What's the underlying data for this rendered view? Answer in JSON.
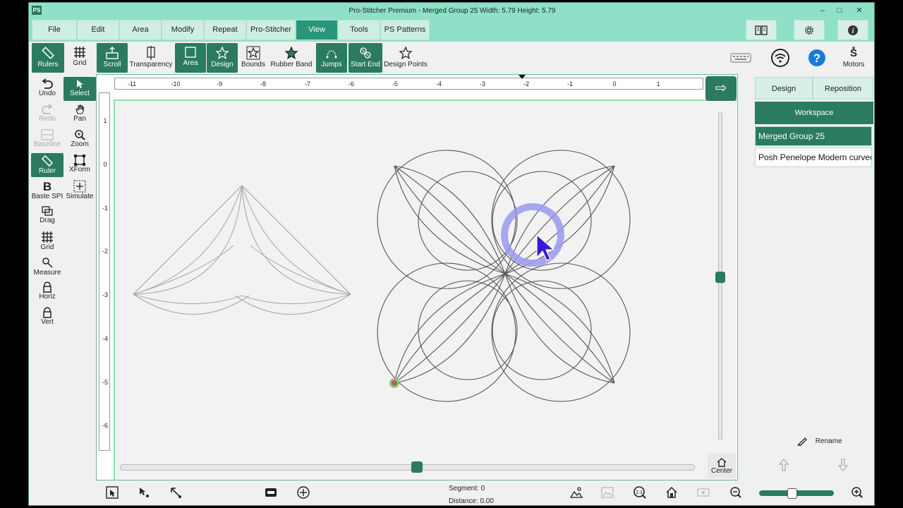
{
  "window": {
    "app_icon_text": "PS",
    "title": "Pro-Stitcher Premium   -   Merged Group 25   Width: 5.79   Height: 5.79"
  },
  "menu": {
    "tabs": [
      "File",
      "Edit",
      "Area",
      "Modify",
      "Repeat",
      "Pro-Stitcher",
      "View",
      "Tools",
      "PS Patterns"
    ],
    "active": "View",
    "right_buttons": [
      "book-icon",
      "gear-icon",
      "info-icon"
    ]
  },
  "toolbar": {
    "items": [
      "Rulers",
      "Grid",
      "Scroll",
      "Transparency",
      "Area",
      "Design",
      "Bounds",
      "Rubber Band",
      "Jumps",
      "Start End",
      "Design Points"
    ],
    "active": [
      "Rulers",
      "Scroll",
      "Area",
      "Design",
      "Jumps",
      "Start End"
    ],
    "motors_label": "Motors"
  },
  "left_tools": {
    "items": [
      "Undo",
      "Select",
      "Redo",
      "Pan",
      "Baseline",
      "Zoom",
      "Ruler",
      "XForm",
      "Baste SPI",
      "Simulate",
      "Drag",
      "Grid",
      "Measure",
      "Horiz",
      "Vert"
    ],
    "active": [
      "Select",
      "Ruler"
    ],
    "disabled": [
      "Redo",
      "Baseline"
    ]
  },
  "rulers": {
    "horizontal_ticks": [
      "-11",
      "-10",
      "-9",
      "-8",
      "-7",
      "-6",
      "-5",
      "-4",
      "-3",
      "-2",
      "-1",
      "0",
      "1"
    ],
    "vertical_ticks": [
      "1",
      "0",
      "-1",
      "-2",
      "-3",
      "-4",
      "-5",
      "-6"
    ]
  },
  "canvas": {
    "center_label": "Center"
  },
  "right_panel": {
    "tabs": [
      "Design",
      "Reposition"
    ],
    "workspace_label": "Workspace",
    "items": [
      "Merged Group 25",
      "Posh Penelope Modern curved"
    ],
    "selected": "Merged Group 25",
    "rename_label": "Rename"
  },
  "status": {
    "segment_label": "Segment:",
    "segment_value": "0",
    "distance_label": "Distance:",
    "distance_value": "0.00"
  },
  "colors": {
    "accent": "#2b7a62",
    "titlebar": "#8fe0c8",
    "cursor_highlight": "#9a9af0"
  }
}
